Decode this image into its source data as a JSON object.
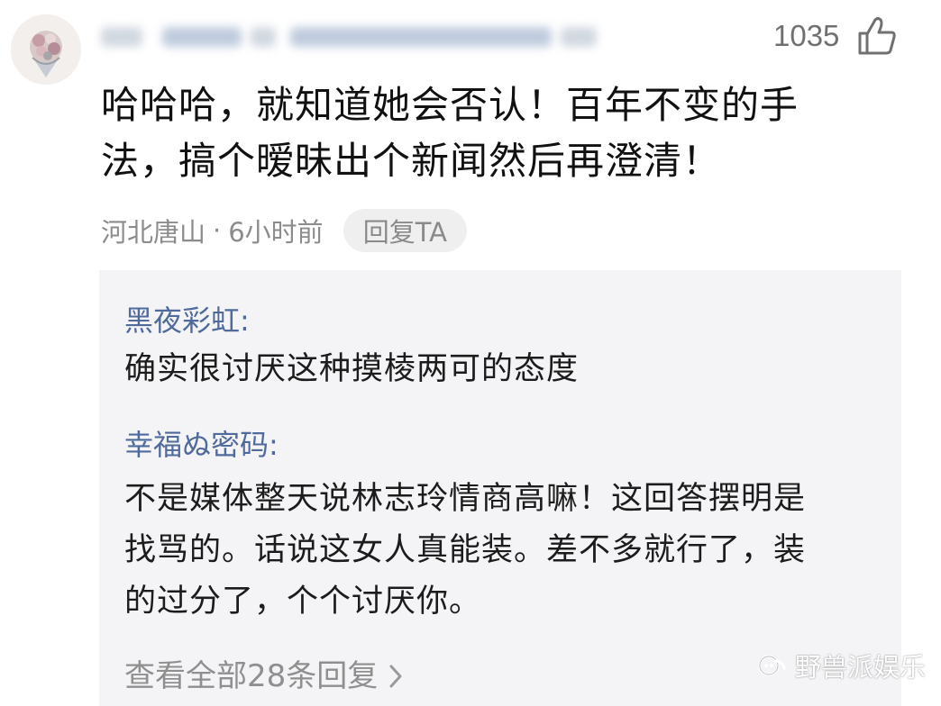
{
  "comment": {
    "like_count": "1035",
    "text_line1": "哈哈哈，就知道她会否认！百年不变的手",
    "text_line2": "法，搞个暧昧出个新闻然后再澄清！",
    "location": "河北唐山",
    "separator": "·",
    "time": "6小时前",
    "reply_button": "回复TA"
  },
  "replies": [
    {
      "author": "黑夜彩虹:",
      "lines": [
        "确实很讨厌这种摸棱两可的态度"
      ]
    },
    {
      "author": "幸福ぬ密码:",
      "lines": [
        "不是媒体整天说林志玲情商高嘛！这回答摆明是",
        "找骂的。话说这女人真能装。差不多就行了，装",
        "的过分了，个个讨厌你。"
      ]
    }
  ],
  "view_all_replies": "查看全部28条回复",
  "watermark": "野兽派娱乐",
  "icons": {
    "like": "thumbs-up-icon",
    "chevron": "chevron-right-icon",
    "watermark": "wechat-official-account-icon"
  },
  "colors": {
    "author_blue": "#4f6a9b",
    "meta_gray": "#8c8c8c",
    "panel_bg": "#f4f4f6"
  }
}
